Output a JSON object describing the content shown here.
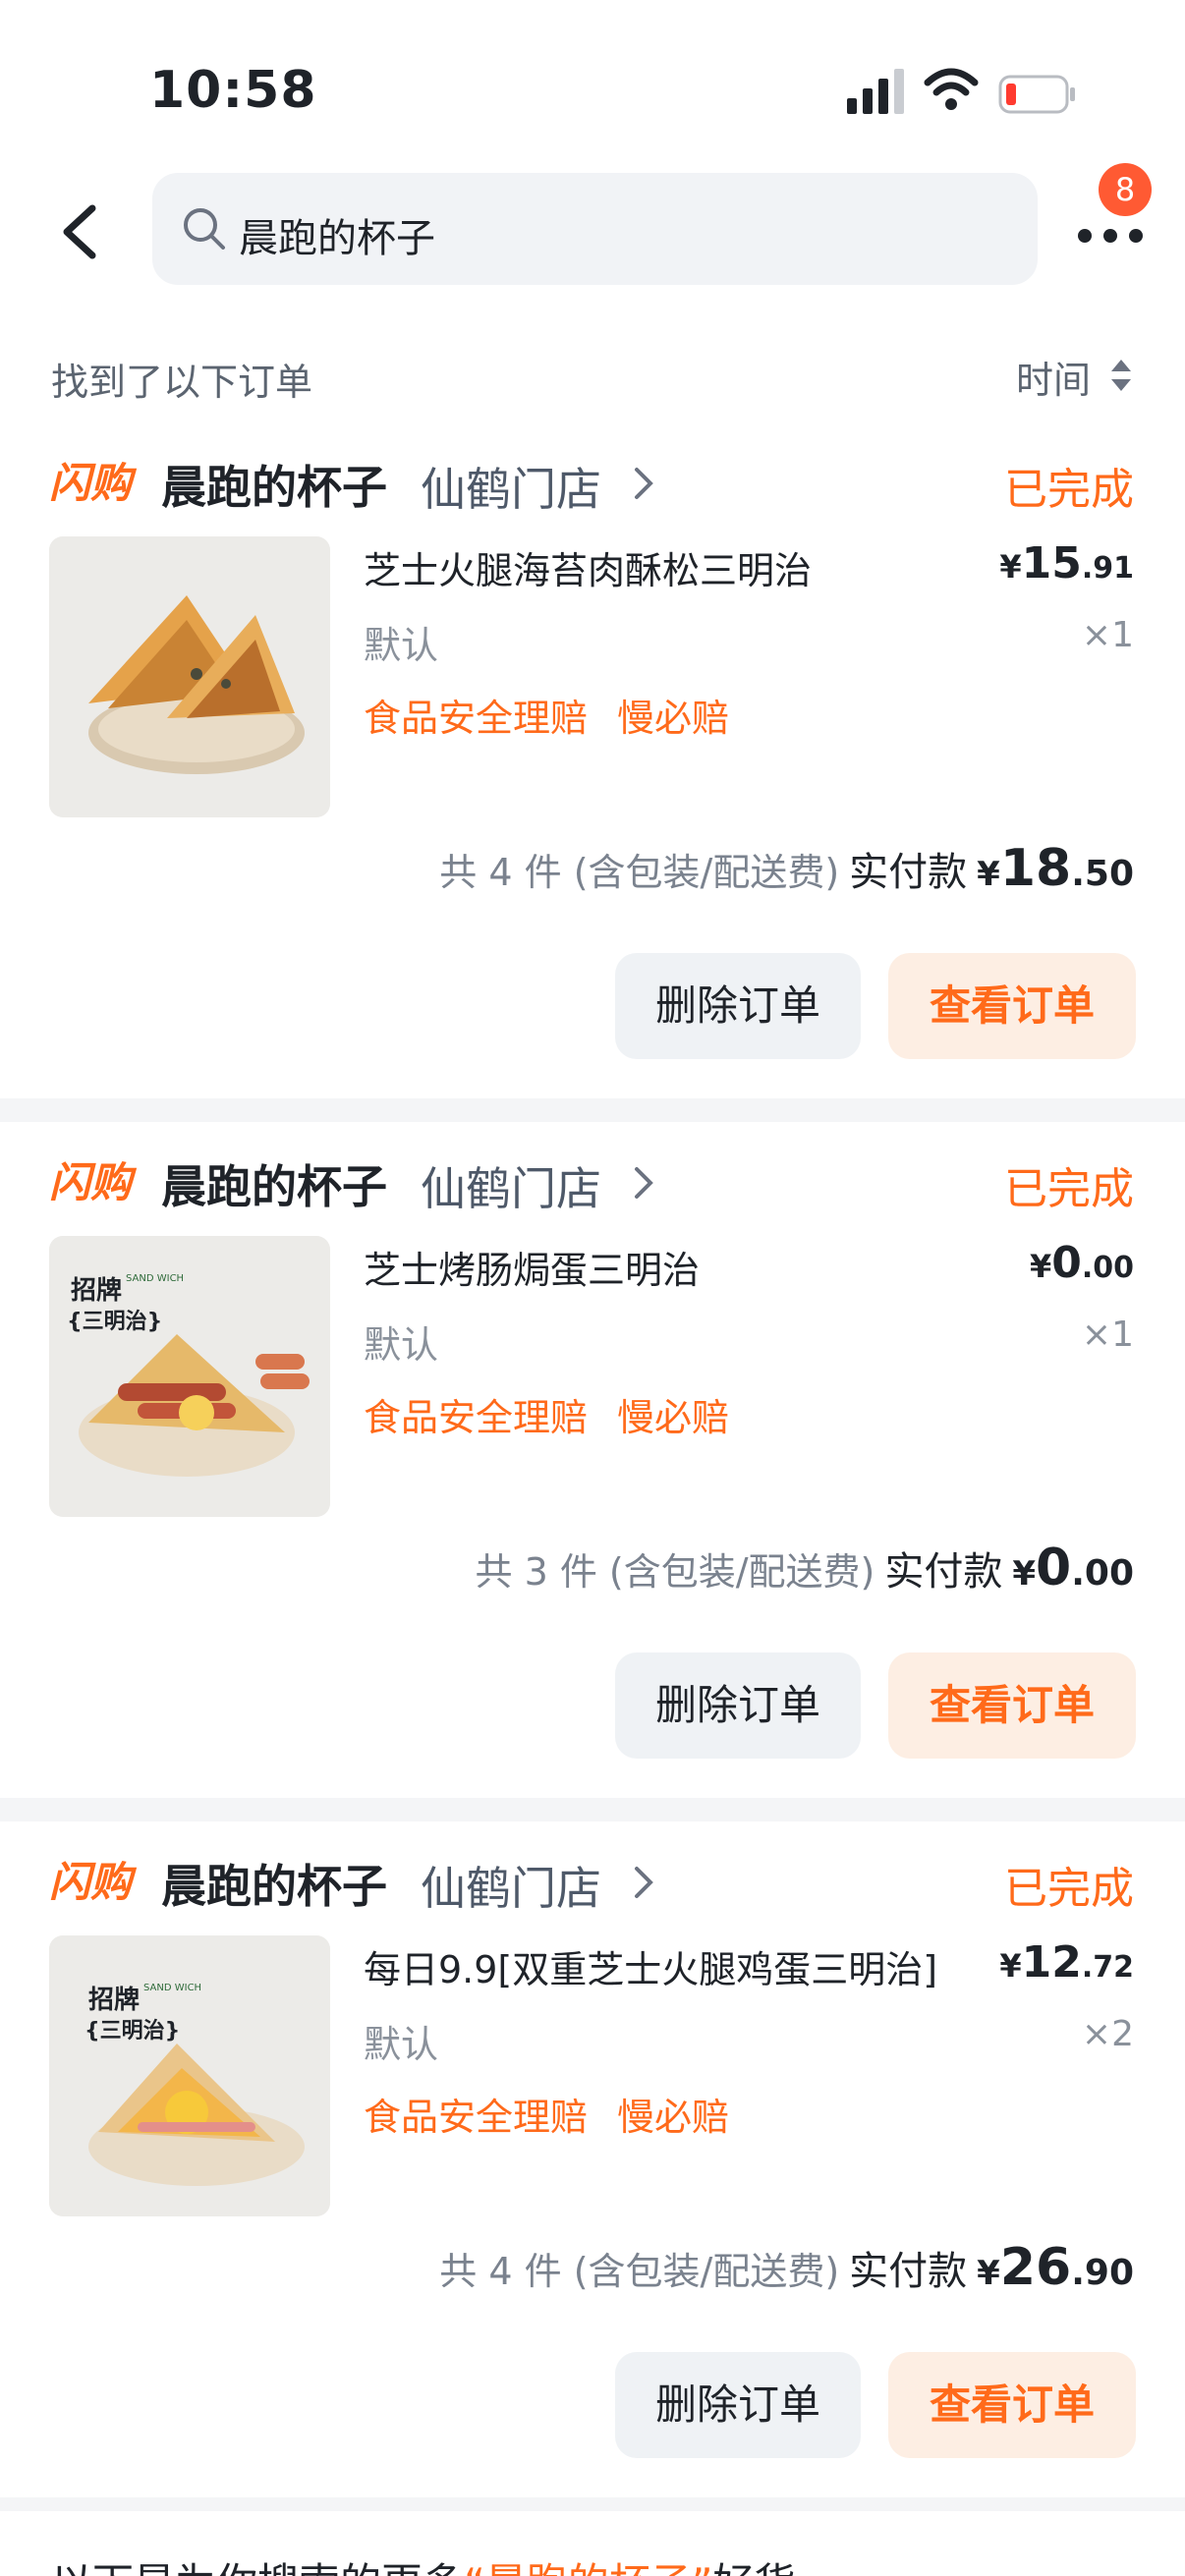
{
  "status_bar": {
    "time": "10:58"
  },
  "header": {
    "search_query": "晨跑的杯子",
    "more_badge": "8"
  },
  "results": {
    "found_text": "找到了以下订单",
    "sort_label": "时间"
  },
  "orders": [
    {
      "platform": "闪购",
      "store": "晨跑的杯子",
      "branch": "仙鹤门店",
      "status": "已完成",
      "product_name": "芝士火腿海苔肉酥松三明治",
      "price_symbol": "¥",
      "price_int": "15",
      "price_dec": ".91",
      "spec": "默认",
      "qty": "×1",
      "tags": [
        "食品安全理赔",
        "慢必赔"
      ],
      "count_text": "共 4 件 (含包装/配送费)",
      "paid_label": "实付款",
      "paid_symbol": "¥",
      "paid_int": "18",
      "paid_dec": ".50",
      "delete_label": "删除订单",
      "view_label": "查看订单"
    },
    {
      "platform": "闪购",
      "store": "晨跑的杯子",
      "branch": "仙鹤门店",
      "status": "已完成",
      "product_name": "芝士烤肠焗蛋三明治",
      "price_symbol": "¥",
      "price_int": "0",
      "price_dec": ".00",
      "spec": "默认",
      "qty": "×1",
      "tags": [
        "食品安全理赔",
        "慢必赔"
      ],
      "count_text": "共 3 件 (含包装/配送费)",
      "paid_label": "实付款",
      "paid_symbol": "¥",
      "paid_int": "0",
      "paid_dec": ".00",
      "delete_label": "删除订单",
      "view_label": "查看订单",
      "thumb_label_1": "招牌",
      "thumb_label_2": "{三明治}",
      "thumb_label_3": "SAND WICH"
    },
    {
      "platform": "闪购",
      "store": "晨跑的杯子",
      "branch": "仙鹤门店",
      "status": "已完成",
      "product_name": "每日9.9[双重芝士火腿鸡蛋三明治]",
      "price_symbol": "¥",
      "price_int": "12",
      "price_dec": ".72",
      "spec": "默认",
      "qty": "×2",
      "tags": [
        "食品安全理赔",
        "慢必赔"
      ],
      "count_text": "共 4 件 (含包装/配送费)",
      "paid_label": "实付款",
      "paid_symbol": "¥",
      "paid_int": "26",
      "paid_dec": ".90",
      "delete_label": "删除订单",
      "view_label": "查看订单",
      "thumb_label_1": "招牌",
      "thumb_label_2": "{三明治}",
      "thumb_label_3": "SAND WICH"
    }
  ],
  "more_section": {
    "prefix": "以下是为你搜索的更多",
    "keyword": "“晨跑的杯子”",
    "suffix": "好货"
  },
  "colors": {
    "accent": "#ff6a1a",
    "badge": "#ff5a33",
    "bg": "#f4f5f7"
  }
}
